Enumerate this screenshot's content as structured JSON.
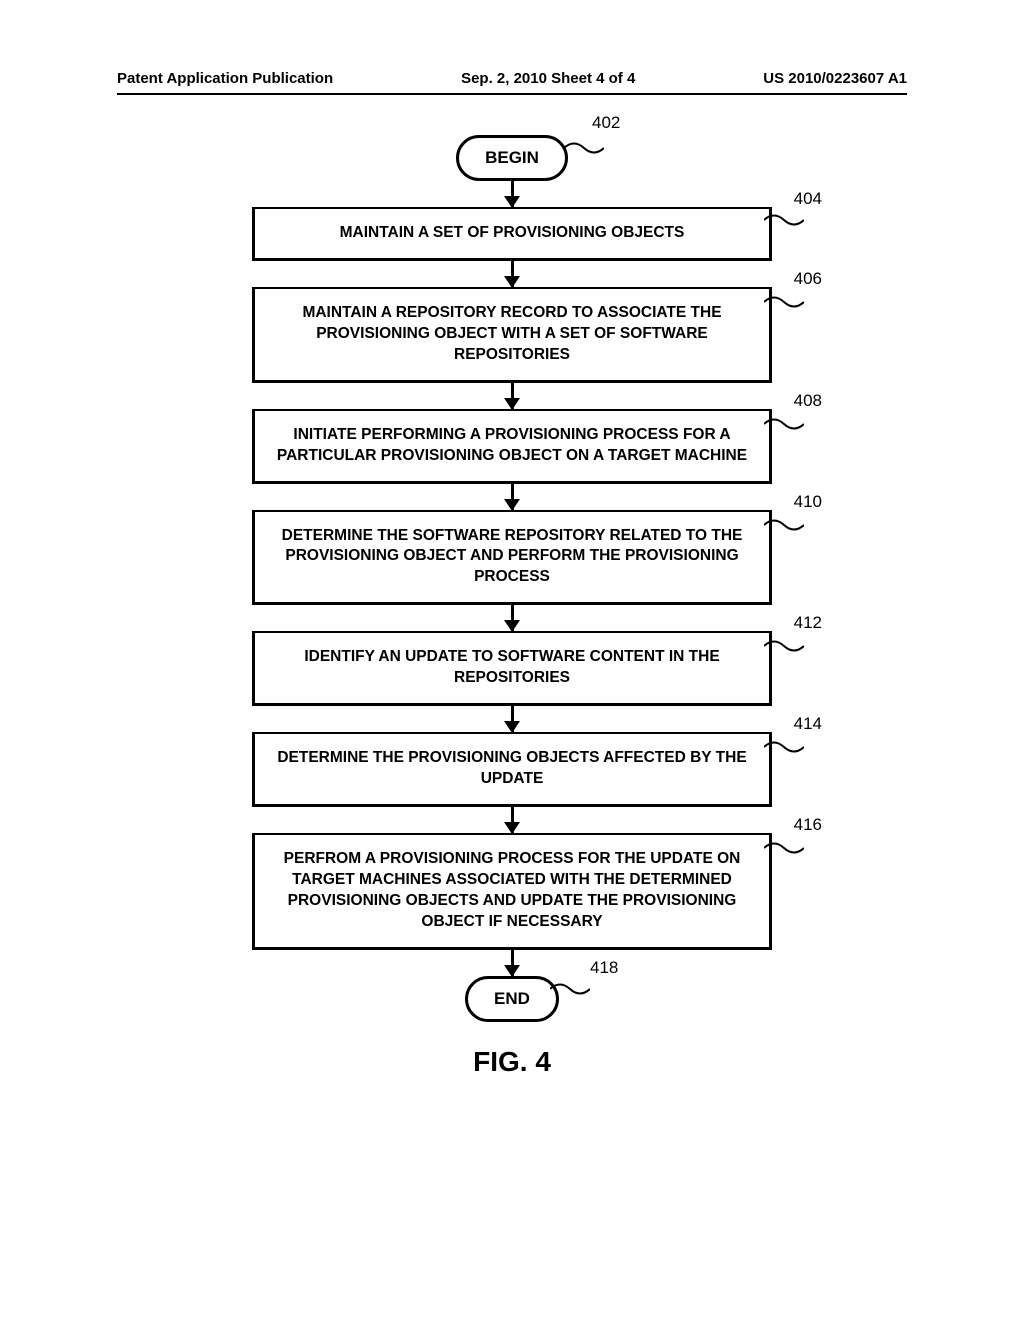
{
  "header": {
    "left": "Patent Application Publication",
    "center": "Sep. 2, 2010  Sheet 4 of 4",
    "right": "US 2010/0223607 A1"
  },
  "flow": {
    "begin": {
      "label": "BEGIN",
      "ref": "402"
    },
    "end": {
      "label": "END",
      "ref": "418"
    },
    "steps": [
      {
        "ref": "404",
        "text": "MAINTAIN A SET OF PROVISIONING OBJECTS"
      },
      {
        "ref": "406",
        "text": "MAINTAIN A REPOSITORY RECORD TO ASSOCIATE THE PROVISIONING OBJECT WITH A SET OF SOFTWARE REPOSITORIES"
      },
      {
        "ref": "408",
        "text": "INITIATE PERFORMING A PROVISIONING PROCESS FOR A PARTICULAR PROVISIONING OBJECT ON A TARGET MACHINE"
      },
      {
        "ref": "410",
        "text": "DETERMINE THE SOFTWARE REPOSITORY RELATED TO THE PROVISIONING OBJECT AND PERFORM THE PROVISIONING PROCESS"
      },
      {
        "ref": "412",
        "text": "IDENTIFY AN UPDATE TO SOFTWARE CONTENT IN THE REPOSITORIES"
      },
      {
        "ref": "414",
        "text": "DETERMINE THE PROVISIONING OBJECTS AFFECTED BY THE UPDATE"
      },
      {
        "ref": "416",
        "text": "PERFROM A PROVISIONING PROCESS FOR THE UPDATE ON TARGET MACHINES ASSOCIATED WITH THE DETERMINED PROVISIONING OBJECTS AND UPDATE THE PROVISIONING OBJECT IF NECESSARY"
      }
    ]
  },
  "caption": "FIG. 4"
}
